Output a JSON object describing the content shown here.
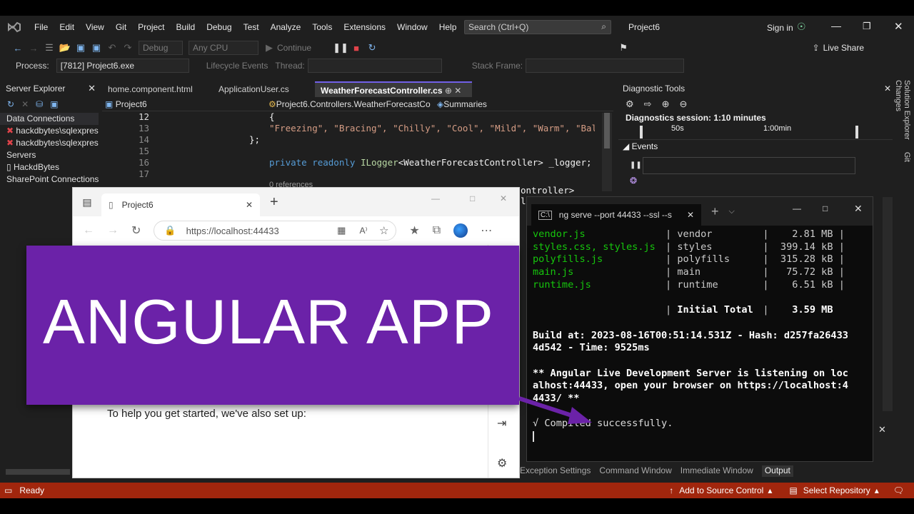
{
  "menu": [
    "File",
    "Edit",
    "View",
    "Git",
    "Project",
    "Build",
    "Debug",
    "Test",
    "Analyze",
    "Tools",
    "Extensions",
    "Window",
    "Help"
  ],
  "search_placeholder": "Search (Ctrl+Q)",
  "solution_name": "Project6",
  "sign_in": "Sign in",
  "toolbar": {
    "config": "Debug",
    "platform": "Any CPU",
    "continue": "Continue",
    "live_share": "Live Share"
  },
  "process_bar": {
    "process_label": "Process:",
    "process_value": "[7812] Project6.exe",
    "lifecycle": "Lifecycle Events",
    "thread": "Thread:",
    "stack_frame": "Stack Frame:"
  },
  "server_explorer": {
    "title": "Server Explorer",
    "items": [
      "Data Connections",
      "hackdbytes\\sqlexpress",
      "hackdbytes\\sqlexpress",
      "Servers",
      "HackdBytes",
      "SharePoint Connections"
    ]
  },
  "editor": {
    "tabs": [
      "home.component.html",
      "ApplicationUser.cs",
      "WeatherForecastController.cs"
    ],
    "nav_project": "Project6",
    "nav_class": "Project6.Controllers.WeatherForecastCo",
    "nav_member": "Summaries",
    "line_numbers": [
      "12",
      "13",
      "14",
      "15",
      "16",
      "17"
    ],
    "code_13": "\"Freezing\", \"Bracing\", \"Chilly\", \"Cool\", \"Mild\", \"Warm\", \"Balmy\", \"Hot\", \"S",
    "code_14": "};",
    "code_16_kw": "private readonly ",
    "code_16_type": "ILogger",
    "code_16_rest": "<WeatherForecastController> _logger;",
    "code_refs": "0 references",
    "code_partial": "ontroller> logger)"
  },
  "diagnostics": {
    "title": "Diagnostic Tools",
    "session": "Diagnostics session: 1:10 minutes",
    "tick1": "50s",
    "tick2": "1:00min",
    "events": "Events"
  },
  "browser": {
    "tab_title": "Project6",
    "url": "https://localhost:44433",
    "help_text": "To help you get started, we've also set up:"
  },
  "banner": {
    "text": "ANGULAR APP"
  },
  "terminal": {
    "tab_title": "ng serve --port 44433 --ssl --s",
    "rows": [
      {
        "file": "vendor.js",
        "name": "vendor",
        "size": "2.81 MB"
      },
      {
        "file": "styles.css, styles.js",
        "name": "styles",
        "size": "399.14 kB"
      },
      {
        "file": "polyfills.js",
        "name": "polyfills",
        "size": "315.28 kB"
      },
      {
        "file": "main.js",
        "name": "main",
        "size": "75.72 kB"
      },
      {
        "file": "runtime.js",
        "name": "runtime",
        "size": "6.51 kB"
      }
    ],
    "total_label": "Initial Total",
    "total_value": "3.59 MB",
    "build_line1": "Build at: 2023-08-16T00:51:14.531Z - Hash: d257fa26433",
    "build_line2": "4d542 - Time: 9525ms",
    "server_line1": "** Angular Live Development Server is listening on loc",
    "server_line2": "alhost:44433, open your browser on https://localhost:4",
    "server_line3": "4433/ **",
    "compiled": "√ Compiled successfully."
  },
  "bottom_tabs": [
    "Exception Settings",
    "Command Window",
    "Immediate Window",
    "Output"
  ],
  "right_rail": [
    "Solution Explorer",
    "Git Changes"
  ],
  "status": {
    "ready": "Ready",
    "source_control": "Add to Source Control",
    "repository": "Select Repository"
  },
  "colors": {
    "status_bar": "#a1260d",
    "banner": "#6b22a8",
    "terminal_green": "#16c60c"
  }
}
